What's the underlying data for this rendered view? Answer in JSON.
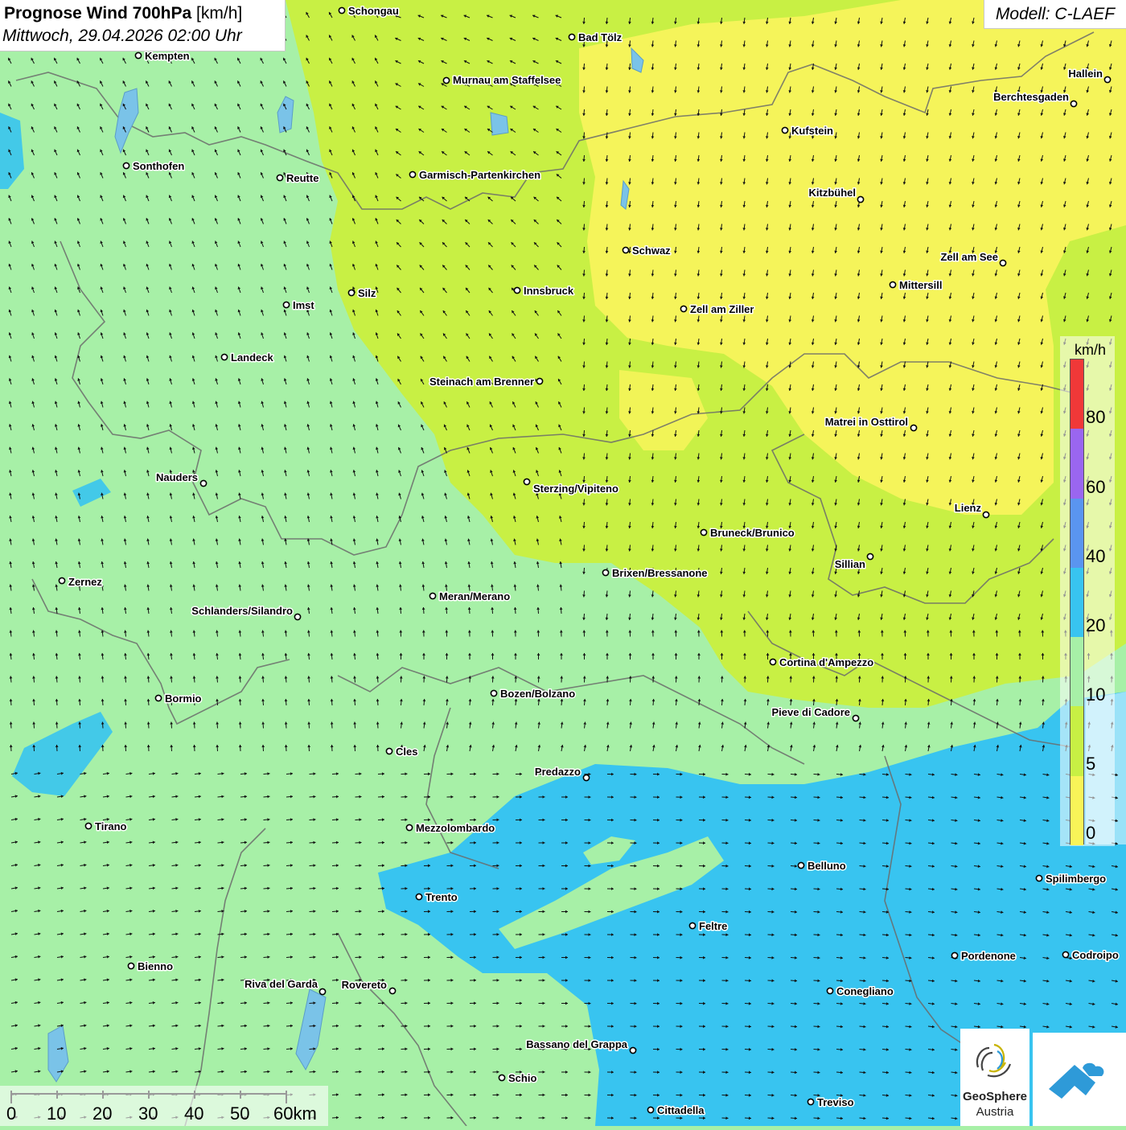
{
  "title": {
    "main": "Prognose Wind 700hPa",
    "unit": "[km/h]",
    "datetime": "Mittwoch, 29.04.2026 02:00 Uhr"
  },
  "model": "Modell: C-LAEF",
  "legend": {
    "unit": "km/h",
    "ticks": [
      "80",
      "60",
      "40",
      "20",
      "10",
      "5",
      "0"
    ],
    "colors": [
      "#f03838",
      "#9a66f0",
      "#5a95f0",
      "#38c4f0",
      "#a7f0a7",
      "#c8f044",
      "#f8f458"
    ]
  },
  "scalebar": {
    "labels": [
      "0",
      "10",
      "20",
      "30",
      "40",
      "50",
      "60km"
    ]
  },
  "logo": {
    "line1": "GeoSphere",
    "line2": "Austria"
  },
  "cities": [
    {
      "name": "Schongau"
    },
    {
      "name": "Bad Tölz"
    },
    {
      "name": "Kempten"
    },
    {
      "name": "Murnau am Staffelsee"
    },
    {
      "name": "Hallein"
    },
    {
      "name": "Berchtesgaden"
    },
    {
      "name": "Kufstein"
    },
    {
      "name": "Sonthofen"
    },
    {
      "name": "Reutte"
    },
    {
      "name": "Garmisch-Partenkirchen"
    },
    {
      "name": "Kitzbühel"
    },
    {
      "name": "Schwaz"
    },
    {
      "name": "Zell am See"
    },
    {
      "name": "Mittersill"
    },
    {
      "name": "Innsbruck"
    },
    {
      "name": "Silz"
    },
    {
      "name": "Imst"
    },
    {
      "name": "Zell am Ziller"
    },
    {
      "name": "Landeck"
    },
    {
      "name": "Steinach am Brenner"
    },
    {
      "name": "Matrei in Osttirol"
    },
    {
      "name": "Nauders"
    },
    {
      "name": "Sterzing/Vipiteno"
    },
    {
      "name": "Lienz"
    },
    {
      "name": "Bruneck/Brunico"
    },
    {
      "name": "Sillian"
    },
    {
      "name": "Brixen/Bressanone"
    },
    {
      "name": "Zernez"
    },
    {
      "name": "Meran/Merano"
    },
    {
      "name": "Schlanders/Silandro"
    },
    {
      "name": "Cortina d'Ampezzo"
    },
    {
      "name": "Bormio"
    },
    {
      "name": "Bozen/Bolzano"
    },
    {
      "name": "Pieve di Cadore"
    },
    {
      "name": "Cles"
    },
    {
      "name": "Predazzo"
    },
    {
      "name": "Tirano"
    },
    {
      "name": "Mezzolombardo"
    },
    {
      "name": "Belluno"
    },
    {
      "name": "Spilimbergo"
    },
    {
      "name": "Trento"
    },
    {
      "name": "Feltre"
    },
    {
      "name": "Pordenone"
    },
    {
      "name": "Codroipo"
    },
    {
      "name": "Bienno"
    },
    {
      "name": "Riva del Garda"
    },
    {
      "name": "Rovereto"
    },
    {
      "name": "Conegliano"
    },
    {
      "name": "Bassano del Grappa"
    },
    {
      "name": "Schio"
    },
    {
      "name": "Treviso"
    },
    {
      "name": "Cittadella"
    }
  ]
}
